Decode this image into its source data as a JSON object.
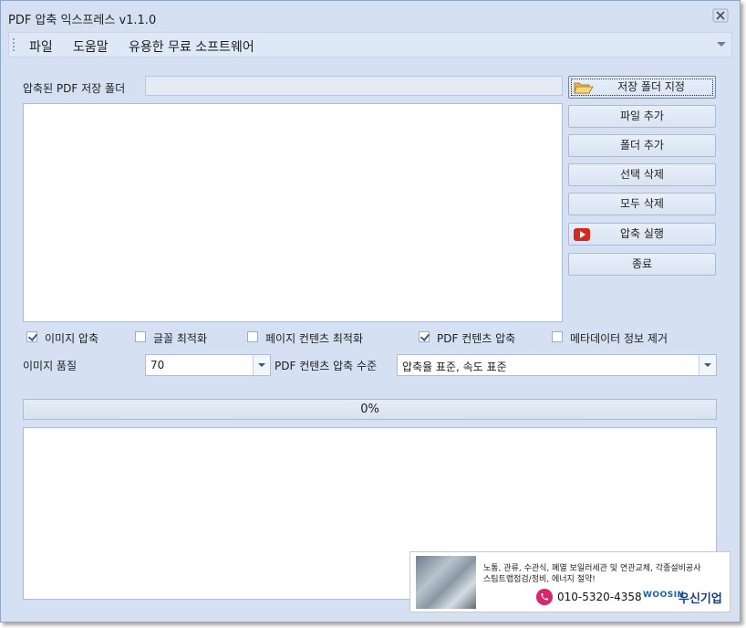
{
  "window": {
    "title": "PDF 압축 익스프레스 v1.1.0"
  },
  "menu": {
    "items": [
      "파일",
      "도움말",
      "유용한 무료 소프트웨어"
    ]
  },
  "save_folder": {
    "label": "압축된 PDF 저장 폴더",
    "value": ""
  },
  "buttons": {
    "set_folder": "저장 폴더 지정",
    "add_file": "파일 추가",
    "add_folder": "폴더 추가",
    "delete_selected": "선택 삭제",
    "delete_all": "모두 삭제",
    "run": "압축 실행",
    "exit": "종료"
  },
  "options": {
    "image_compress": {
      "label": "이미지 압축",
      "checked": true
    },
    "font_optimize": {
      "label": "글꼴 최적화",
      "checked": false
    },
    "page_contents_optimize": {
      "label": "페이지 컨텐츠 최적화",
      "checked": false
    },
    "pdf_contents_compress": {
      "label": "PDF 컨텐츠 압축",
      "checked": true
    },
    "remove_metadata": {
      "label": "메타데이터 정보 제거",
      "checked": false
    }
  },
  "image_quality": {
    "label": "이미지 품질",
    "value": "70"
  },
  "compress_level": {
    "label": "PDF 컨텐츠 압축 수준",
    "value": "압축율 표준, 속도 표준"
  },
  "progress": {
    "text": "0%",
    "value": 0
  },
  "ad": {
    "line1": "노통, 관류, 수관식, 폐열 보일러세관 및 연관교체, 각종설비공사",
    "line2": "스팀트랩점검/정비, 에너지 절약!",
    "phone": "010-5320-4358",
    "logo_en": "WOOSIN",
    "logo_ko": "우신기업"
  },
  "colors": {
    "window_bg": "#d5e1f2",
    "accent_phone": "#d9276e",
    "logo_blue": "#1b5fa8"
  }
}
